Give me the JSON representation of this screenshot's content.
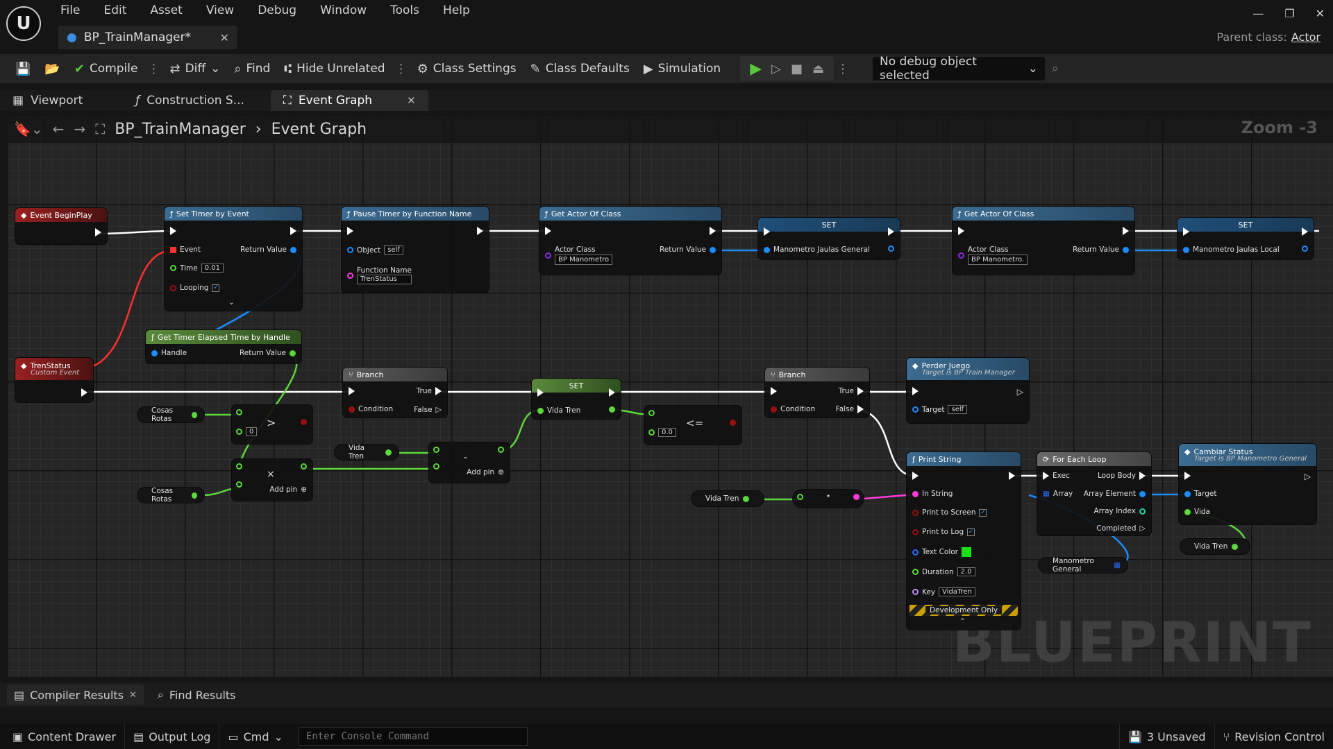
{
  "app": {
    "menu": [
      "File",
      "Edit",
      "Asset",
      "View",
      "Debug",
      "Window",
      "Tools",
      "Help"
    ],
    "asset_tab": "BP_TrainManager*",
    "parent_class_label": "Parent class:",
    "parent_class_value": "Actor"
  },
  "toolbar": {
    "compile": "Compile",
    "diff": "Diff",
    "find": "Find",
    "hide_unrelated": "Hide Unrelated",
    "class_settings": "Class Settings",
    "class_defaults": "Class Defaults",
    "simulation": "Simulation",
    "debug_object": "No debug object selected"
  },
  "doc_tabs": [
    "Viewport",
    "Construction S...",
    "Event Graph"
  ],
  "breadcrumb": {
    "blueprint": "BP_TrainManager",
    "graph": "Event Graph",
    "zoom": "Zoom -3"
  },
  "watermark": "BLUEPRINT",
  "nodes": {
    "begin_play": "Event BeginPlay",
    "set_timer": {
      "title": "Set Timer by Event",
      "event": "Event",
      "return_value": "Return Value",
      "time": "Time",
      "time_val": "0.01",
      "looping": "Looping"
    },
    "pause_timer": {
      "title": "Pause Timer by Function Name",
      "object": "Object",
      "object_val": "self",
      "function_name": "Function Name",
      "function_val": "TrenStatus"
    },
    "get_actor_1": {
      "title": "Get Actor Of Class",
      "actor_class": "Actor Class",
      "class_val": "BP Manometro",
      "return_value": "Return Value"
    },
    "set_1": {
      "title": "SET",
      "var": "Manometro Jaulas General"
    },
    "get_actor_2": {
      "title": "Get Actor Of Class",
      "actor_class": "Actor Class",
      "class_val": "BP Manometro.",
      "return_value": "Return Value"
    },
    "set_2": {
      "title": "SET",
      "var": "Manometro Jaulas Local"
    },
    "get_elapsed": {
      "title": "Get Timer Elapsed Time by Handle",
      "handle": "Handle",
      "return_value": "Return Value"
    },
    "tren_status": {
      "title": "TrenStatus",
      "subtitle": "Custom Event"
    },
    "branch_1": {
      "title": "Branch",
      "condition": "Condition",
      "true": "True",
      "false": "False"
    },
    "greater": {
      "op": ">",
      "val": "0"
    },
    "multiply": {
      "op": "×",
      "add_pin": "Add pin"
    },
    "set_vida": {
      "title": "SET",
      "var": "Vida Tren"
    },
    "subtract": {
      "op": "-",
      "add_pin": "Add pin"
    },
    "lessequal": {
      "op": "<=",
      "val": "0.0"
    },
    "branch_2": {
      "title": "Branch",
      "condition": "Condition",
      "true": "True",
      "false": "False"
    },
    "perder_juego": {
      "title": "Perder Juego",
      "subtitle": "Target is BP Train Manager",
      "target": "Target",
      "target_val": "self"
    },
    "print_string": {
      "title": "Print String",
      "in_string": "In String",
      "print_screen": "Print to Screen",
      "print_log": "Print to Log",
      "text_color": "Text Color",
      "duration": "Duration",
      "duration_val": "2.0",
      "key": "Key",
      "key_val": "VidaTren",
      "dev_only": "Development Only"
    },
    "for_each": {
      "title": "For Each Loop",
      "exec": "Exec",
      "array": "Array",
      "loop_body": "Loop Body",
      "array_element": "Array Element",
      "array_index": "Array Index",
      "completed": "Completed"
    },
    "cambiar_status": {
      "title": "Cambiar Status",
      "subtitle": "Target is BP Manometro General",
      "target": "Target",
      "vida": "Vida"
    },
    "vars": {
      "cosas_rotas": "Cosas Rotas",
      "vida_tren": "Vida Tren",
      "manometro_general": "Manometro General"
    },
    "convert": "•"
  },
  "bottom_tabs": [
    "Compiler Results",
    "Find Results"
  ],
  "status": {
    "content_drawer": "Content Drawer",
    "output_log": "Output Log",
    "cmd": "Cmd",
    "console_placeholder": "Enter Console Command",
    "unsaved": "3 Unsaved",
    "revision_control": "Revision Control"
  },
  "colors": {
    "exec": "#ffffff",
    "object": "#1c8cff",
    "float": "#5cd83a",
    "string": "#ff3bd8",
    "struct": "#2b6cff",
    "event_header": "#9a2020",
    "func_header": "#3c6c92"
  }
}
